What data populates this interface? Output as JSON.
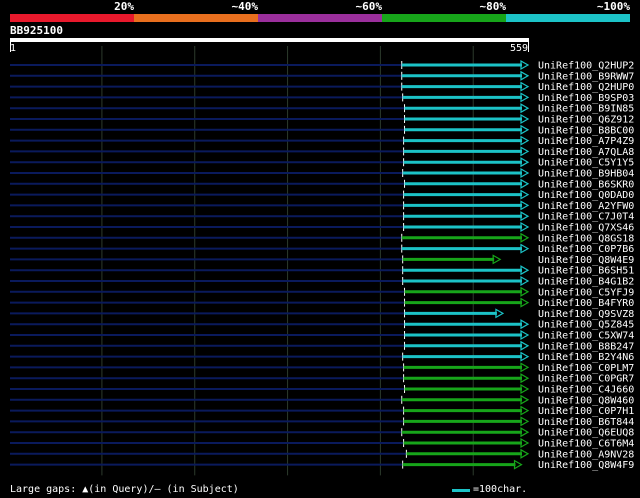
{
  "scale": {
    "labels": [
      "20%",
      "~40%",
      "~60%",
      "~80%",
      "~100%"
    ],
    "colors": [
      "#e8192c",
      "#e86f1e",
      "#9b2f9c",
      "#17a51a",
      "#1cc3c7"
    ]
  },
  "query": {
    "name": "BB925100",
    "start": "1",
    "end": "559",
    "length": 559
  },
  "colors": {
    "background": "#000000",
    "query_bar": "#ffffff",
    "gap_line": "#0a1a5c",
    "grid_line": "#2c3a2c"
  },
  "footer": {
    "gaps_text": "Large gaps: ▲(in Query)/— (in Subject)",
    "scale_text": "=100char.",
    "scale_color": "#1cc3c7"
  },
  "chart_data": {
    "type": "alignment",
    "query_length": 559,
    "hits": [
      {
        "name": "UniRef100_Q2HUP2",
        "start": 423,
        "end": 559,
        "identity": "~100%"
      },
      {
        "name": "UniRef100_B9RWW7",
        "start": 423,
        "end": 559,
        "identity": "~100%"
      },
      {
        "name": "UniRef100_Q2HUP0",
        "start": 423,
        "end": 559,
        "identity": "~100%"
      },
      {
        "name": "UniRef100_B9SP03",
        "start": 424,
        "end": 559,
        "identity": "~100%"
      },
      {
        "name": "UniRef100_B9IN85",
        "start": 426,
        "end": 559,
        "identity": "~100%"
      },
      {
        "name": "UniRef100_Q6Z912",
        "start": 426,
        "end": 559,
        "identity": "~100%"
      },
      {
        "name": "UniRef100_B8BC00",
        "start": 426,
        "end": 559,
        "identity": "~100%"
      },
      {
        "name": "UniRef100_A7P4Z9",
        "start": 425,
        "end": 559,
        "identity": "~100%"
      },
      {
        "name": "UniRef100_A7QLA8",
        "start": 425,
        "end": 559,
        "identity": "~100%"
      },
      {
        "name": "UniRef100_C5Y1Y5",
        "start": 425,
        "end": 559,
        "identity": "~100%"
      },
      {
        "name": "UniRef100_B9HB04",
        "start": 424,
        "end": 559,
        "identity": "~100%"
      },
      {
        "name": "UniRef100_B6SKR0",
        "start": 426,
        "end": 559,
        "identity": "~100%"
      },
      {
        "name": "UniRef100_Q0DAD0",
        "start": 425,
        "end": 559,
        "identity": "~100%"
      },
      {
        "name": "UniRef100_A2YFW0",
        "start": 425,
        "end": 559,
        "identity": "~100%"
      },
      {
        "name": "UniRef100_C7J0T4",
        "start": 425,
        "end": 559,
        "identity": "~100%"
      },
      {
        "name": "UniRef100_Q7XS46",
        "start": 425,
        "end": 559,
        "identity": "~100%"
      },
      {
        "name": "UniRef100_Q8GS18",
        "start": 423,
        "end": 559,
        "identity": "~80%"
      },
      {
        "name": "UniRef100_C0P7B6",
        "start": 423,
        "end": 559,
        "identity": "~100%"
      },
      {
        "name": "UniRef100_Q8W4E9",
        "start": 424,
        "end": 529,
        "identity": "~80%"
      },
      {
        "name": "UniRef100_B6SH51",
        "start": 424,
        "end": 559,
        "identity": "~100%"
      },
      {
        "name": "UniRef100_B4G1B2",
        "start": 424,
        "end": 559,
        "identity": "~100%"
      },
      {
        "name": "UniRef100_C5YFJ9",
        "start": 426,
        "end": 559,
        "identity": "~80%"
      },
      {
        "name": "UniRef100_B4FYR0",
        "start": 426,
        "end": 559,
        "identity": "~80%"
      },
      {
        "name": "UniRef100_Q9SVZ8",
        "start": 426,
        "end": 532,
        "identity": "~100%"
      },
      {
        "name": "UniRef100_Q5Z845",
        "start": 426,
        "end": 559,
        "identity": "~100%"
      },
      {
        "name": "UniRef100_C5XW74",
        "start": 426,
        "end": 559,
        "identity": "~100%"
      },
      {
        "name": "UniRef100_B8B247",
        "start": 426,
        "end": 559,
        "identity": "~100%"
      },
      {
        "name": "UniRef100_B2Y4N6",
        "start": 424,
        "end": 559,
        "identity": "~100%"
      },
      {
        "name": "UniRef100_C0PLM7",
        "start": 425,
        "end": 559,
        "identity": "~80%"
      },
      {
        "name": "UniRef100_C0PGR7",
        "start": 425,
        "end": 559,
        "identity": "~80%"
      },
      {
        "name": "UniRef100_C4J660",
        "start": 426,
        "end": 559,
        "identity": "~80%"
      },
      {
        "name": "UniRef100_Q8W460",
        "start": 423,
        "end": 559,
        "identity": "~80%"
      },
      {
        "name": "UniRef100_C0P7H1",
        "start": 425,
        "end": 559,
        "identity": "~80%"
      },
      {
        "name": "UniRef100_B6T844",
        "start": 425,
        "end": 559,
        "identity": "~80%"
      },
      {
        "name": "UniRef100_Q6EUQ8",
        "start": 423,
        "end": 559,
        "identity": "~80%"
      },
      {
        "name": "UniRef100_C6T6M4",
        "start": 425,
        "end": 559,
        "identity": "~80%"
      },
      {
        "name": "UniRef100_A9NV28",
        "start": 428,
        "end": 559,
        "identity": "~80%"
      },
      {
        "name": "UniRef100_Q8W4F9",
        "start": 424,
        "end": 552,
        "identity": "~80%"
      }
    ]
  }
}
